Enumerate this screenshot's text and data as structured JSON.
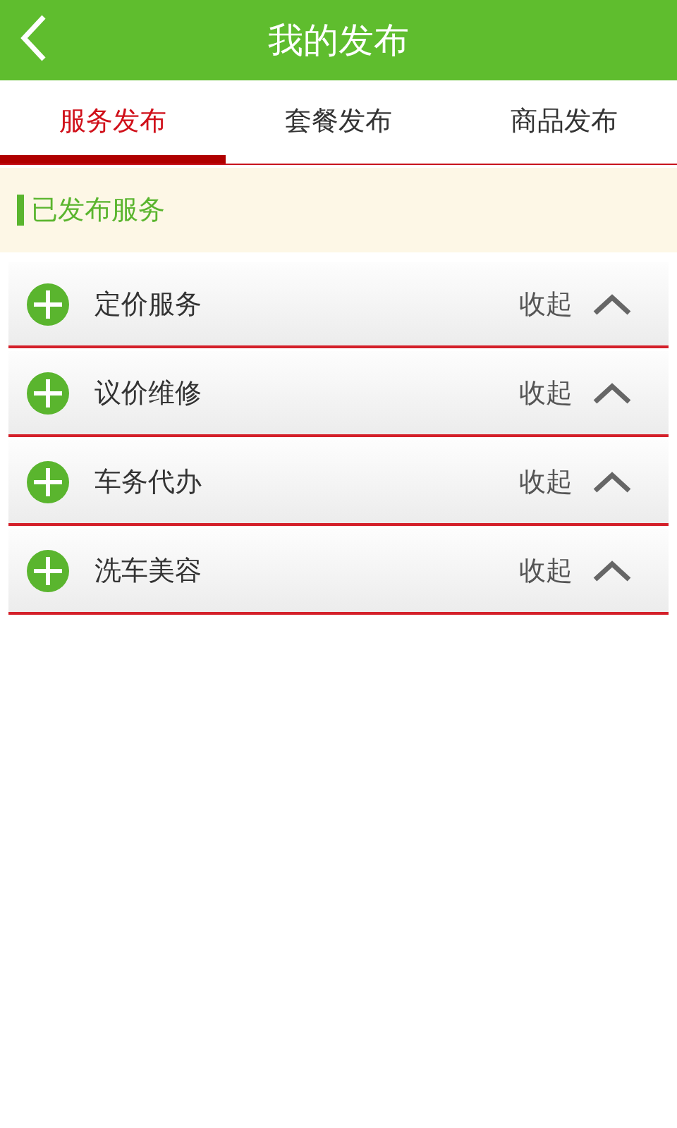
{
  "header": {
    "title": "我的发布"
  },
  "tabs": [
    {
      "label": "服务发布",
      "selected": true
    },
    {
      "label": "套餐发布",
      "selected": false
    },
    {
      "label": "商品发布",
      "selected": false
    }
  ],
  "section": {
    "title": "已发布服务"
  },
  "categories": [
    {
      "name": "定价服务",
      "toggle": "收起",
      "expanded": true
    },
    {
      "name": "议价维修",
      "toggle": "收起",
      "expanded": true
    },
    {
      "name": "车务代办",
      "toggle": "收起",
      "expanded": true
    },
    {
      "name": "洗车美容",
      "toggle": "收起",
      "expanded": true
    }
  ]
}
